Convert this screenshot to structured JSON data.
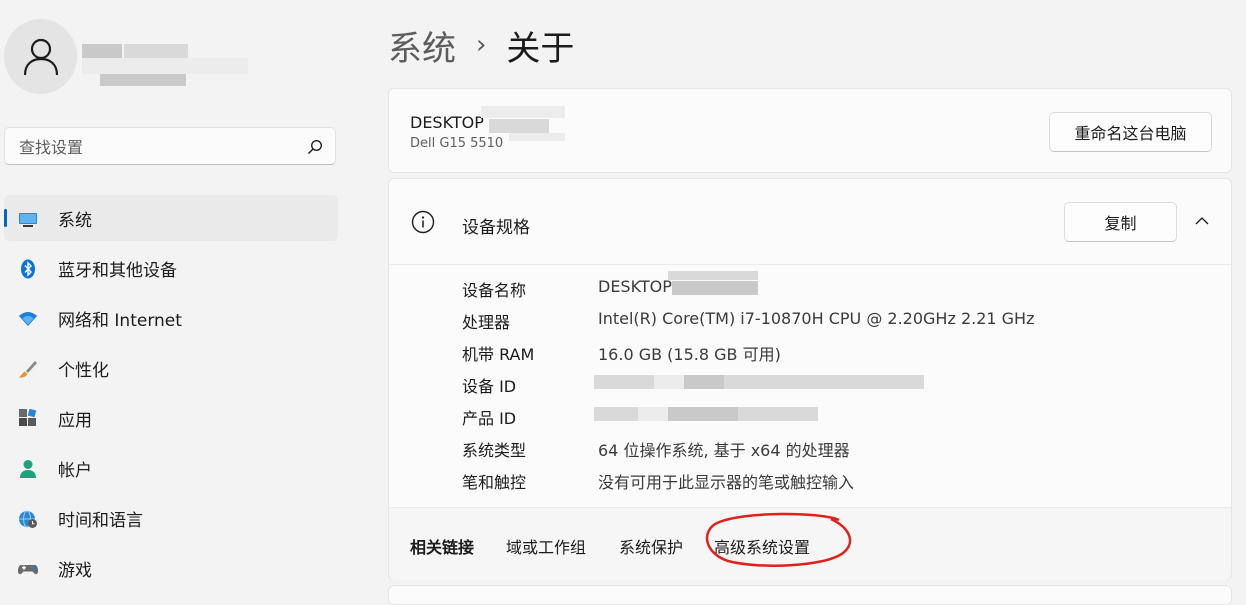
{
  "user": {
    "avatar_icon": "person-icon"
  },
  "search": {
    "placeholder": "查找设置",
    "icon": "search-icon"
  },
  "nav": {
    "items": [
      {
        "label": "系统",
        "icon": "monitor-icon",
        "active": true
      },
      {
        "label": "蓝牙和其他设备",
        "icon": "bluetooth-icon"
      },
      {
        "label": "网络和 Internet",
        "icon": "wifi-icon"
      },
      {
        "label": "个性化",
        "icon": "brush-icon"
      },
      {
        "label": "应用",
        "icon": "apps-icon"
      },
      {
        "label": "帐户",
        "icon": "account-icon"
      },
      {
        "label": "时间和语言",
        "icon": "globe-clock-icon"
      },
      {
        "label": "游戏",
        "icon": "gamepad-icon"
      }
    ]
  },
  "breadcrumb": {
    "parent": "系统",
    "separator": "›",
    "current": "关于"
  },
  "device": {
    "name": "DESKTOP",
    "model": "Dell G15 5510",
    "rename_button": "重命名这台电脑"
  },
  "specs": {
    "title": "设备规格",
    "copy_button": "复制",
    "rows": [
      {
        "key": "设备名称",
        "value": "DESKTOP"
      },
      {
        "key": "处理器",
        "value": "Intel(R) Core(TM) i7-10870H CPU @ 2.20GHz   2.21 GHz"
      },
      {
        "key": "机带 RAM",
        "value": "16.0 GB (15.8 GB 可用)"
      },
      {
        "key": "设备 ID",
        "value": ""
      },
      {
        "key": "产品 ID",
        "value": ""
      },
      {
        "key": "系统类型",
        "value": "64 位操作系统, 基于 x64 的处理器"
      },
      {
        "key": "笔和触控",
        "value": "没有可用于此显示器的笔或触控输入"
      }
    ]
  },
  "related": {
    "label": "相关链接",
    "links": [
      "域或工作组",
      "系统保护",
      "高级系统设置"
    ]
  },
  "colors": {
    "accent": "#0067c0",
    "annotation": "#e0201b"
  }
}
